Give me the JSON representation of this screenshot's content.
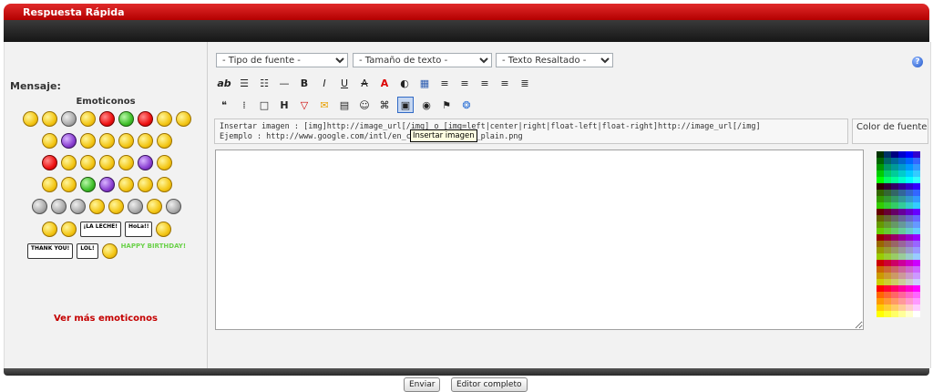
{
  "window": {
    "title": "Respuesta Rápida"
  },
  "left": {
    "message_label": "Mensaje:",
    "emoticons_title": "Emoticonos",
    "more_link": "Ver más emoticonos",
    "sign_lala": "¡LA LECHE!",
    "sign_hola": "HoLa!!",
    "sign_thank": "THANK YOU!",
    "sign_lol": "LOL!",
    "sign_birthday": "HAPPY BIRTHDAY!",
    "emoticons_rows": [
      [
        "smile",
        "confused",
        "sleepy",
        "cool",
        "angry",
        "dance",
        "devil",
        "wink",
        "tongue"
      ],
      [
        "happy",
        "grin",
        "shifty",
        "glasses",
        "silly",
        "question",
        "smirk"
      ],
      [
        "horns",
        "roll",
        "laugh",
        "glance",
        "chef",
        "sad",
        "blush"
      ],
      [
        "shy",
        "wave",
        "green",
        "eyes",
        "cute",
        "hungry",
        "trophy"
      ],
      [
        "grin2",
        "hmm",
        "joke",
        "heart",
        "yellow",
        "zzz",
        "cool2",
        "spin"
      ]
    ]
  },
  "editor": {
    "font_select": "- Tipo de fuente -",
    "size_select": "- Tamaño de texto -",
    "highlight_select": "- Texto Resaltado -",
    "help_label": "?",
    "info_line1": "Insertar imagen : [img]http://image_url[/img] o [img=left|center|right|float-left|float-right]http://image_url[/img]",
    "info_line2": "Ejemplo : http://www.google.com/intl/en_com/images/logo_plain.png",
    "color_label": "Color de fuente",
    "tooltip": "Insertar imagen",
    "toolbar1": [
      {
        "name": "font-ab-icon",
        "glyph": "ab"
      },
      {
        "name": "bullet-list-icon",
        "glyph": "☰"
      },
      {
        "name": "numbered-list-icon",
        "glyph": "☷"
      },
      {
        "name": "horizontal-rule-icon",
        "glyph": "—"
      },
      {
        "name": "bold-icon",
        "glyph": "B"
      },
      {
        "name": "italic-icon",
        "glyph": "I"
      },
      {
        "name": "underline-icon",
        "glyph": "U"
      },
      {
        "name": "strikethrough-icon",
        "glyph": "A"
      },
      {
        "name": "font-color-icon",
        "glyph": "A"
      },
      {
        "name": "highlight-icon",
        "glyph": "◐"
      },
      {
        "name": "gradient-icon",
        "glyph": "▦"
      },
      {
        "name": "align-left-icon",
        "glyph": "≡"
      },
      {
        "name": "align-center-icon",
        "glyph": "≡"
      },
      {
        "name": "align-right-icon",
        "glyph": "≡"
      },
      {
        "name": "justify-icon",
        "glyph": "≡"
      },
      {
        "name": "indent-icon",
        "glyph": "≣"
      }
    ],
    "toolbar2": [
      {
        "name": "quote-icon",
        "glyph": "❝"
      },
      {
        "name": "code-icon",
        "glyph": "⁞"
      },
      {
        "name": "box-icon",
        "glyph": "□"
      },
      {
        "name": "heading-icon",
        "glyph": "H"
      },
      {
        "name": "spoiler-icon",
        "glyph": "▽"
      },
      {
        "name": "speech-icon",
        "glyph": "✉"
      },
      {
        "name": "table-icon",
        "glyph": "▤"
      },
      {
        "name": "users-icon",
        "glyph": "☺"
      },
      {
        "name": "link-icon",
        "glyph": "⌘"
      },
      {
        "name": "insert-image-icon",
        "glyph": "▣"
      },
      {
        "name": "eye-icon",
        "glyph": "◉"
      },
      {
        "name": "flash-icon",
        "glyph": "⚑"
      },
      {
        "name": "globe-icon",
        "glyph": "❂"
      }
    ],
    "palette_colors": [
      "#003300",
      "#003366",
      "#000080",
      "#0000cc",
      "#0000ff",
      "#3300cc",
      "#006600",
      "#006666",
      "#006699",
      "#0066cc",
      "#0066ff",
      "#3366ff",
      "#009900",
      "#009966",
      "#009999",
      "#0099cc",
      "#0099ff",
      "#3399ff",
      "#00cc00",
      "#00cc66",
      "#00cc99",
      "#00cccc",
      "#00ccff",
      "#33ccff",
      "#00ff00",
      "#00ff66",
      "#00ff99",
      "#00ffcc",
      "#00ffff",
      "#33ffff",
      "#330000",
      "#330033",
      "#330066",
      "#330099",
      "#3300cc",
      "#3300ff",
      "#336600",
      "#336633",
      "#336666",
      "#336699",
      "#3366cc",
      "#3366ff",
      "#339900",
      "#339933",
      "#339966",
      "#339999",
      "#3399cc",
      "#3399ff",
      "#33cc00",
      "#33cc33",
      "#33cc66",
      "#33cc99",
      "#33cccc",
      "#33ccff",
      "#660000",
      "#660033",
      "#660066",
      "#660099",
      "#6600cc",
      "#6600ff",
      "#666600",
      "#666633",
      "#666666",
      "#666699",
      "#6666cc",
      "#6666ff",
      "#669900",
      "#669933",
      "#669966",
      "#669999",
      "#6699cc",
      "#6699ff",
      "#66cc00",
      "#66cc33",
      "#66cc66",
      "#66cc99",
      "#66cccc",
      "#66ccff",
      "#990000",
      "#990033",
      "#990066",
      "#990099",
      "#9900cc",
      "#9900ff",
      "#996600",
      "#996633",
      "#996666",
      "#996699",
      "#9966cc",
      "#9966ff",
      "#999900",
      "#999933",
      "#999966",
      "#999999",
      "#9999cc",
      "#9999ff",
      "#99cc00",
      "#99cc33",
      "#99cc66",
      "#99cc99",
      "#99cccc",
      "#99ccff",
      "#cc0000",
      "#cc0033",
      "#cc0066",
      "#cc0099",
      "#cc00cc",
      "#cc00ff",
      "#cc6600",
      "#cc6633",
      "#cc6666",
      "#cc6699",
      "#cc66cc",
      "#cc66ff",
      "#cc9900",
      "#cc9933",
      "#cc9966",
      "#cc9999",
      "#cc99cc",
      "#cc99ff",
      "#cccc00",
      "#cccc33",
      "#cccc66",
      "#cccc99",
      "#cccccc",
      "#ccccff",
      "#ff0000",
      "#ff0033",
      "#ff0066",
      "#ff0099",
      "#ff00cc",
      "#ff00ff",
      "#ff6600",
      "#ff6633",
      "#ff6666",
      "#ff6699",
      "#ff66cc",
      "#ff66ff",
      "#ff9900",
      "#ff9933",
      "#ff9966",
      "#ff9999",
      "#ff99cc",
      "#ff99ff",
      "#ffcc00",
      "#ffcc33",
      "#ffcc66",
      "#ffcc99",
      "#ffcccc",
      "#ffccff",
      "#ffff00",
      "#ffff33",
      "#ffff66",
      "#ffff99",
      "#ffffcc",
      "#ffffff"
    ]
  },
  "footer": {
    "send_button": "Enviar",
    "preview_button": "Editor completo"
  }
}
